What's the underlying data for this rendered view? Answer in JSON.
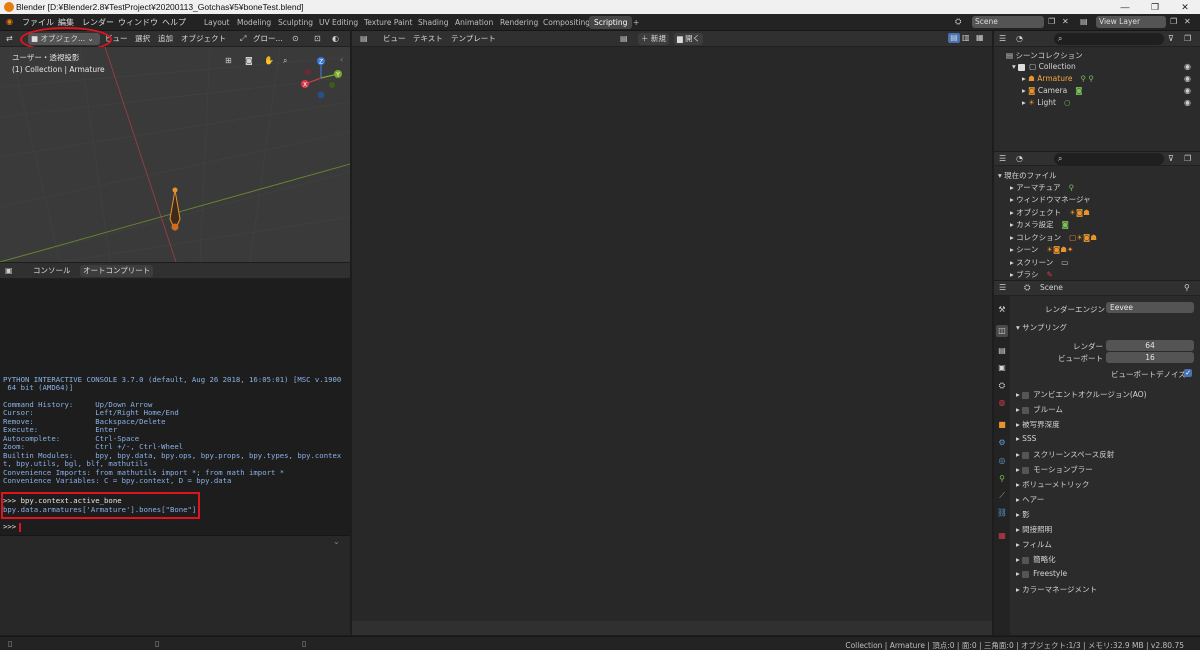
{
  "window": {
    "title": "Blender [D:¥Blender2.8¥TestProject¥20200113_Gotchas¥5¥boneTest.blend]",
    "controls": [
      "—",
      "❐",
      "✕"
    ]
  },
  "topbar": {
    "menus": [
      "ファイル",
      "編集",
      "レンダー",
      "ウィンドウ",
      "ヘルプ"
    ],
    "workspaces": [
      "Layout",
      "Modeling",
      "Sculpting",
      "UV Editing",
      "Texture Paint",
      "Shading",
      "Animation",
      "Rendering",
      "Compositing",
      "Scripting",
      "+"
    ],
    "active_workspace": "Scripting",
    "scene": "Scene",
    "view_layer": "View Layer"
  },
  "viewport": {
    "mode": "オブジェク...",
    "menus": [
      "ビュー",
      "選択",
      "追加",
      "オブジェクト"
    ],
    "transform": "グロー...",
    "overlay_line1": "ユーザー・透視投影",
    "overlay_line2": "(1) Collection | Armature",
    "gizmo": {
      "x": "X",
      "y": "Y",
      "z": "Z"
    }
  },
  "console": {
    "tabs": [
      "コンソール",
      "オートコンプリート"
    ],
    "lines": [
      "PYTHON INTERACTIVE CONSOLE 3.7.0 (default, Aug 26 2018, 16:05:01) [MSC v.1900",
      " 64 bit (AMD64)]",
      "",
      "Command History:     Up/Down Arrow",
      "Cursor:              Left/Right Home/End",
      "Remove:              Backspace/Delete",
      "Execute:             Enter",
      "Autocomplete:        Ctrl-Space",
      "Zoom:                Ctrl +/-, Ctrl-Wheel",
      "Builtin Modules:     bpy, bpy.data, bpy.ops, bpy.props, bpy.types, bpy.contex",
      "t, bpy.utils, bgl, blf, mathutils",
      "Convenience Imports: from mathutils import *; from math import *",
      "Convenience Variables: C = bpy.context, D = bpy.data"
    ],
    "input_line": ">>> bpy.context.active_bone",
    "output_line": "bpy.data.armatures['Armature'].bones[\"Bone\"]",
    "prompt": ">>> "
  },
  "text_editor": {
    "menus": [
      "ビュー",
      "テキスト",
      "テンプレート"
    ],
    "new_label": "新規",
    "open_label": "開く"
  },
  "outliner": {
    "title": "シーンコレクション",
    "items": [
      {
        "label": "Collection",
        "color": "#d4d4d4"
      },
      {
        "label": "Armature",
        "color": "#f5a742"
      },
      {
        "label": "Camera",
        "color": "#d4d4d4"
      },
      {
        "label": "Light",
        "color": "#d4d4d4"
      }
    ]
  },
  "file_browser": {
    "title": "現在のファイル",
    "items": [
      "アーマチュア",
      "ウィンドウマネージャ",
      "オブジェクト",
      "カメラ設定",
      "コレクション",
      "シーン",
      "スクリーン",
      "ブラシ"
    ]
  },
  "properties": {
    "context": "Scene",
    "render_engine_label": "レンダーエンジン",
    "render_engine_value": "Eevee",
    "sampling_title": "サンプリング",
    "render_label": "レンダー",
    "render_value": "64",
    "viewport_label": "ビューポート",
    "viewport_value": "16",
    "denoise_label": "ビューポートデノイズ",
    "sections": [
      {
        "label": "アンビエントオクルージョン(AO)",
        "checkbox": true
      },
      {
        "label": "ブルーム",
        "checkbox": true
      },
      {
        "label": "被写界深度",
        "checkbox": false
      },
      {
        "label": "SSS",
        "checkbox": false
      },
      {
        "label": "スクリーンスペース反射",
        "checkbox": true
      },
      {
        "label": "モーションブラー",
        "checkbox": true
      },
      {
        "label": "ボリューメトリック",
        "checkbox": false
      },
      {
        "label": "ヘアー",
        "checkbox": false
      },
      {
        "label": "影",
        "checkbox": false
      },
      {
        "label": "間接照明",
        "checkbox": false
      },
      {
        "label": "フィルム",
        "checkbox": false
      },
      {
        "label": "簡略化",
        "checkbox": true
      },
      {
        "label": "Freestyle",
        "checkbox": true
      },
      {
        "label": "カラーマネージメント",
        "checkbox": false
      }
    ]
  },
  "statusbar": {
    "text": "Collection | Armature | 頂点:0 | 面:0 | 三角面:0 | オブジェクト:1/3 | メモリ:32.9 MB | v2.80.75"
  },
  "colors": {
    "accent": "#4772b3",
    "highlight_red": "#e0141e",
    "armature": "#f5a742"
  }
}
